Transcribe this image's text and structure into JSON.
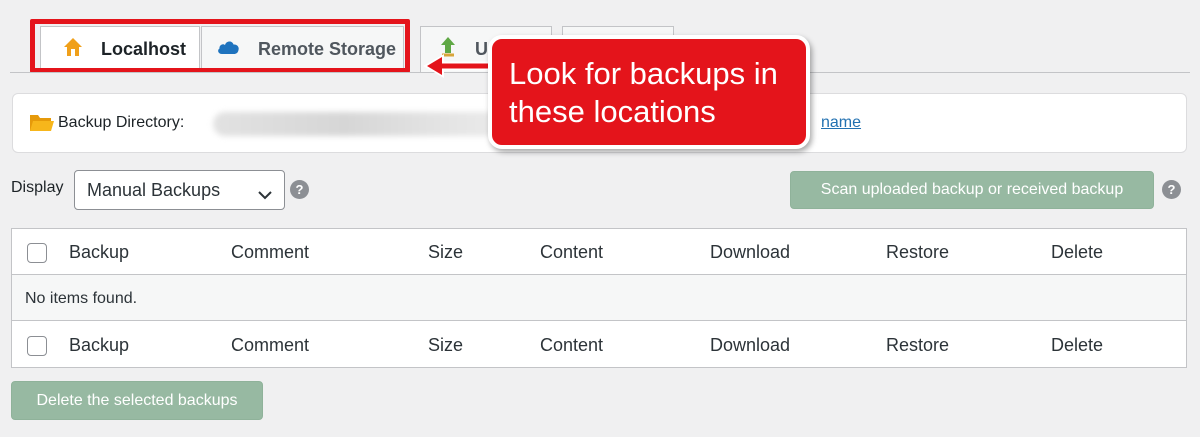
{
  "tabs": [
    {
      "label": "Localhost",
      "icon": "home-icon",
      "active": true
    },
    {
      "label": "Remote Storage",
      "icon": "cloud-icon",
      "active": false
    },
    {
      "label": "U",
      "icon": "upload-icon",
      "active": false
    },
    {
      "label": "",
      "icon": "",
      "active": false
    }
  ],
  "backup_directory": {
    "label": "Backup Directory:",
    "icon": "folder-icon",
    "rename_link": "name"
  },
  "callout": {
    "line1": "Look for backups in",
    "line2": "these locations",
    "color": "#e4141b"
  },
  "display": {
    "label": "Display",
    "selected": "Manual Backups"
  },
  "scan_button": "Scan uploaded backup or received backup",
  "table": {
    "columns": [
      "Backup",
      "Comment",
      "Size",
      "Content",
      "Download",
      "Restore",
      "Delete"
    ],
    "empty_message": "No items found."
  },
  "delete_button": "Delete the selected backups",
  "colors": {
    "highlight": "#e4141b",
    "disabled_button": "#97b9a2",
    "link": "#2271b1"
  }
}
